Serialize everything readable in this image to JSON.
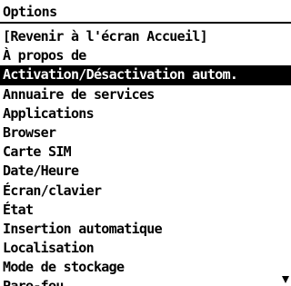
{
  "screen": {
    "title": "Options"
  },
  "menu": {
    "selected_index": 2,
    "items": [
      "[Revenir à l'écran Accueil]",
      "À propos de",
      "Activation/Désactivation autom.",
      "Annuaire de services",
      "Applications",
      "Browser",
      "Carte SIM",
      "Date/Heure",
      "Écran/clavier",
      "État",
      "Insertion automatique",
      "Localisation",
      "Mode de stockage",
      "Pare-feu"
    ]
  },
  "scroll": {
    "indicator": "down-arrow-icon"
  }
}
